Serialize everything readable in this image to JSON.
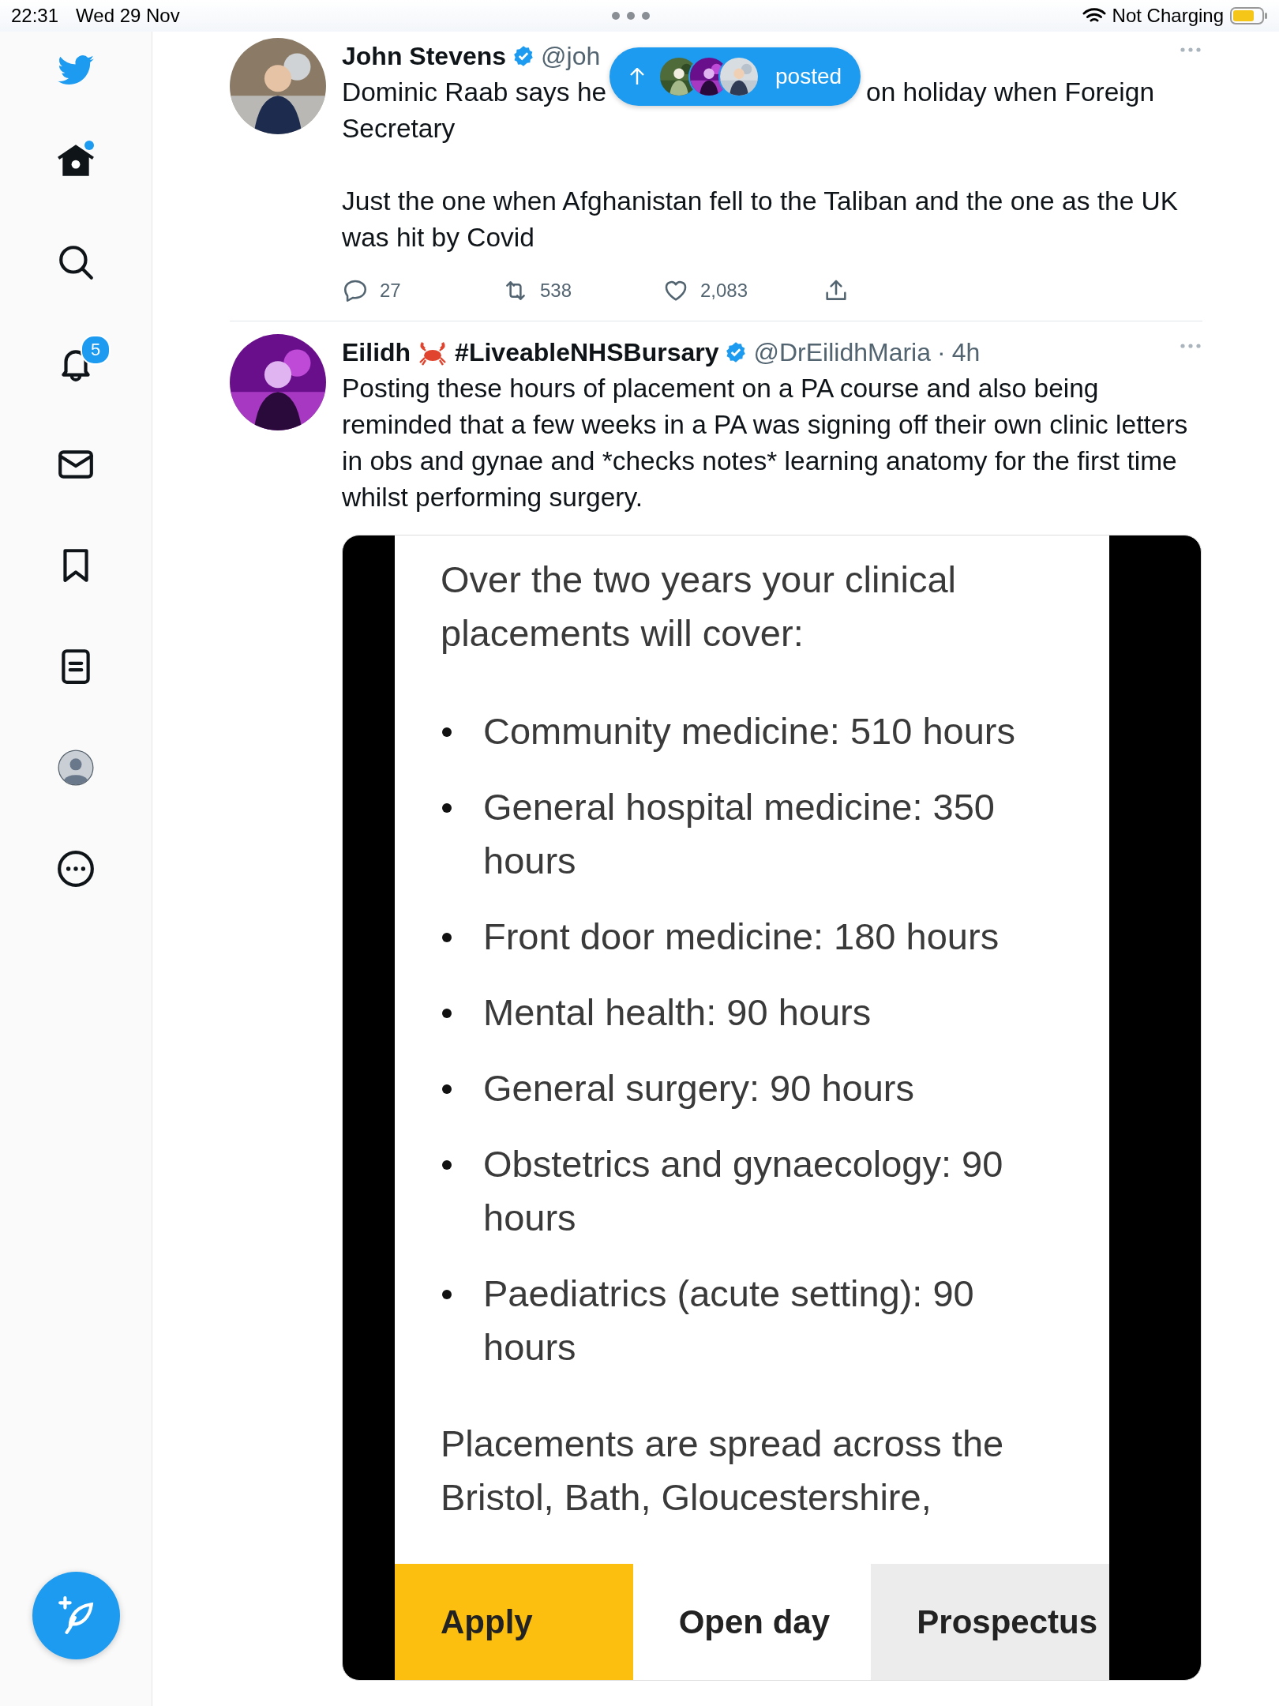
{
  "status_bar": {
    "time": "22:31",
    "date": "Wed 29 Nov",
    "charging_label": "Not Charging"
  },
  "sidebar": {
    "items": [
      {
        "kind": "logo"
      },
      {
        "kind": "home",
        "dot": true
      },
      {
        "kind": "search"
      },
      {
        "kind": "notifications",
        "badge": "5"
      },
      {
        "kind": "messages"
      },
      {
        "kind": "bookmarks"
      },
      {
        "kind": "lists"
      },
      {
        "kind": "profile"
      },
      {
        "kind": "more"
      }
    ]
  },
  "new_posts_pill": {
    "label": "posted"
  },
  "tweets": [
    {
      "name": "John Stevens",
      "verified": true,
      "handle": "@joh",
      "body": [
        {
          "kind": "gap_line",
          "before": "Dominic Raab says he",
          "after": "on holiday when Foreign"
        },
        {
          "kind": "line",
          "text": "Secretary"
        },
        {
          "kind": "paragraph",
          "text": "Just the one when Afghanistan fell to the Taliban and the one as the UK was hit by Covid"
        }
      ],
      "actions": {
        "replies": "27",
        "retweets": "538",
        "likes": "2,083"
      }
    },
    {
      "name": "Eilidh",
      "name_suffix": "#LiveableNHSBursary",
      "verified": true,
      "handle": "@DrEilidhMaria",
      "separator": "·",
      "time": "4h",
      "body": [
        {
          "kind": "line",
          "text": "Posting these hours of placement on a PA course and also being reminded that a few weeks in a PA was signing off their own clinic letters in obs and gynae and *checks notes* learning anatomy for the first time whilst performing surgery."
        }
      ],
      "media": {
        "heading": "Over the two years your clinical placements will cover:",
        "bullets": [
          "Community medicine: 510 hours",
          "General hospital medicine: 350 hours",
          "Front door medicine: 180 hours",
          "Mental health: 90 hours",
          "General surgery: 90 hours",
          "Obstetrics and gynaecology: 90 hours",
          "Paediatrics (acute setting): 90 hours"
        ],
        "footer": "Placements are spread across the Bristol, Bath, Gloucestershire,",
        "buttons": [
          {
            "label": "Apply",
            "color": "#fdbf0f"
          },
          {
            "label": "Open day",
            "color": "#ffffff"
          },
          {
            "label": "Prospectus",
            "color": "#ececec"
          }
        ]
      }
    }
  ]
}
